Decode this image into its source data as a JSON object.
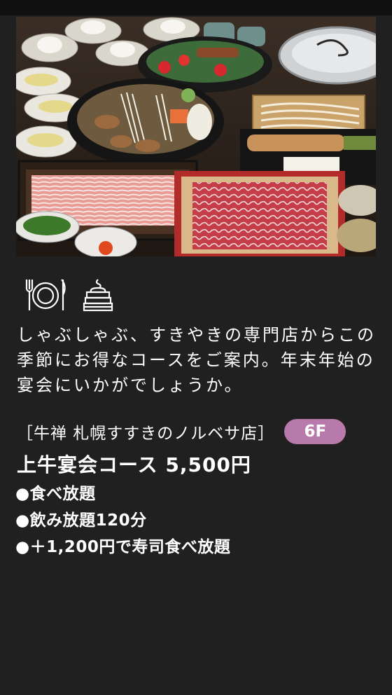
{
  "hero": {
    "description": "Shabu-shabu and sukiyaki course meal spread: platters of sliced pork and marbled wagyu, vegetable nabe, rice bowls, udon"
  },
  "icons": [
    "plate-cutlery-icon",
    "sweets-tiered-icon"
  ],
  "description": "しゃぶしゃぶ、すきやきの専門店からこの季節にお得なコースをご案内。年末年始の宴会にいかがでしょうか。",
  "shop": {
    "name": "［牛禅 札幌すすきのノルベサ店］",
    "floor": "6F"
  },
  "course": {
    "title": "上牛宴会コース 5,500円"
  },
  "features": [
    "●食べ放題",
    "●飲み放題120分",
    "●＋1,200円で寿司食べ放題"
  ],
  "colors": {
    "background": "#202020",
    "text": "#ffffff",
    "badge": "#b77aab"
  }
}
